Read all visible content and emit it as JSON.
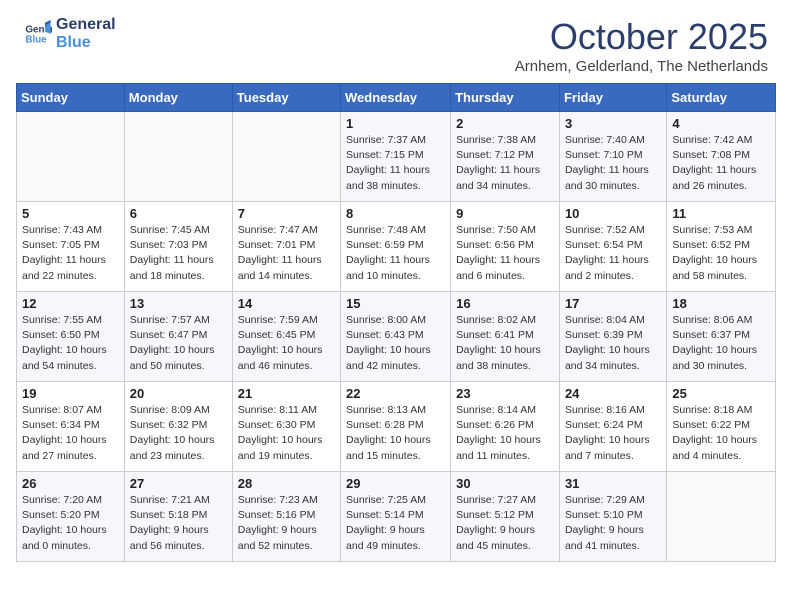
{
  "header": {
    "logo_line1": "General",
    "logo_line2": "Blue",
    "month": "October 2025",
    "location": "Arnhem, Gelderland, The Netherlands"
  },
  "weekdays": [
    "Sunday",
    "Monday",
    "Tuesday",
    "Wednesday",
    "Thursday",
    "Friday",
    "Saturday"
  ],
  "weeks": [
    [
      {
        "day": "",
        "info": ""
      },
      {
        "day": "",
        "info": ""
      },
      {
        "day": "",
        "info": ""
      },
      {
        "day": "1",
        "info": "Sunrise: 7:37 AM\nSunset: 7:15 PM\nDaylight: 11 hours\nand 38 minutes."
      },
      {
        "day": "2",
        "info": "Sunrise: 7:38 AM\nSunset: 7:12 PM\nDaylight: 11 hours\nand 34 minutes."
      },
      {
        "day": "3",
        "info": "Sunrise: 7:40 AM\nSunset: 7:10 PM\nDaylight: 11 hours\nand 30 minutes."
      },
      {
        "day": "4",
        "info": "Sunrise: 7:42 AM\nSunset: 7:08 PM\nDaylight: 11 hours\nand 26 minutes."
      }
    ],
    [
      {
        "day": "5",
        "info": "Sunrise: 7:43 AM\nSunset: 7:05 PM\nDaylight: 11 hours\nand 22 minutes."
      },
      {
        "day": "6",
        "info": "Sunrise: 7:45 AM\nSunset: 7:03 PM\nDaylight: 11 hours\nand 18 minutes."
      },
      {
        "day": "7",
        "info": "Sunrise: 7:47 AM\nSunset: 7:01 PM\nDaylight: 11 hours\nand 14 minutes."
      },
      {
        "day": "8",
        "info": "Sunrise: 7:48 AM\nSunset: 6:59 PM\nDaylight: 11 hours\nand 10 minutes."
      },
      {
        "day": "9",
        "info": "Sunrise: 7:50 AM\nSunset: 6:56 PM\nDaylight: 11 hours\nand 6 minutes."
      },
      {
        "day": "10",
        "info": "Sunrise: 7:52 AM\nSunset: 6:54 PM\nDaylight: 11 hours\nand 2 minutes."
      },
      {
        "day": "11",
        "info": "Sunrise: 7:53 AM\nSunset: 6:52 PM\nDaylight: 10 hours\nand 58 minutes."
      }
    ],
    [
      {
        "day": "12",
        "info": "Sunrise: 7:55 AM\nSunset: 6:50 PM\nDaylight: 10 hours\nand 54 minutes."
      },
      {
        "day": "13",
        "info": "Sunrise: 7:57 AM\nSunset: 6:47 PM\nDaylight: 10 hours\nand 50 minutes."
      },
      {
        "day": "14",
        "info": "Sunrise: 7:59 AM\nSunset: 6:45 PM\nDaylight: 10 hours\nand 46 minutes."
      },
      {
        "day": "15",
        "info": "Sunrise: 8:00 AM\nSunset: 6:43 PM\nDaylight: 10 hours\nand 42 minutes."
      },
      {
        "day": "16",
        "info": "Sunrise: 8:02 AM\nSunset: 6:41 PM\nDaylight: 10 hours\nand 38 minutes."
      },
      {
        "day": "17",
        "info": "Sunrise: 8:04 AM\nSunset: 6:39 PM\nDaylight: 10 hours\nand 34 minutes."
      },
      {
        "day": "18",
        "info": "Sunrise: 8:06 AM\nSunset: 6:37 PM\nDaylight: 10 hours\nand 30 minutes."
      }
    ],
    [
      {
        "day": "19",
        "info": "Sunrise: 8:07 AM\nSunset: 6:34 PM\nDaylight: 10 hours\nand 27 minutes."
      },
      {
        "day": "20",
        "info": "Sunrise: 8:09 AM\nSunset: 6:32 PM\nDaylight: 10 hours\nand 23 minutes."
      },
      {
        "day": "21",
        "info": "Sunrise: 8:11 AM\nSunset: 6:30 PM\nDaylight: 10 hours\nand 19 minutes."
      },
      {
        "day": "22",
        "info": "Sunrise: 8:13 AM\nSunset: 6:28 PM\nDaylight: 10 hours\nand 15 minutes."
      },
      {
        "day": "23",
        "info": "Sunrise: 8:14 AM\nSunset: 6:26 PM\nDaylight: 10 hours\nand 11 minutes."
      },
      {
        "day": "24",
        "info": "Sunrise: 8:16 AM\nSunset: 6:24 PM\nDaylight: 10 hours\nand 7 minutes."
      },
      {
        "day": "25",
        "info": "Sunrise: 8:18 AM\nSunset: 6:22 PM\nDaylight: 10 hours\nand 4 minutes."
      }
    ],
    [
      {
        "day": "26",
        "info": "Sunrise: 7:20 AM\nSunset: 5:20 PM\nDaylight: 10 hours\nand 0 minutes."
      },
      {
        "day": "27",
        "info": "Sunrise: 7:21 AM\nSunset: 5:18 PM\nDaylight: 9 hours\nand 56 minutes."
      },
      {
        "day": "28",
        "info": "Sunrise: 7:23 AM\nSunset: 5:16 PM\nDaylight: 9 hours\nand 52 minutes."
      },
      {
        "day": "29",
        "info": "Sunrise: 7:25 AM\nSunset: 5:14 PM\nDaylight: 9 hours\nand 49 minutes."
      },
      {
        "day": "30",
        "info": "Sunrise: 7:27 AM\nSunset: 5:12 PM\nDaylight: 9 hours\nand 45 minutes."
      },
      {
        "day": "31",
        "info": "Sunrise: 7:29 AM\nSunset: 5:10 PM\nDaylight: 9 hours\nand 41 minutes."
      },
      {
        "day": "",
        "info": ""
      }
    ]
  ]
}
